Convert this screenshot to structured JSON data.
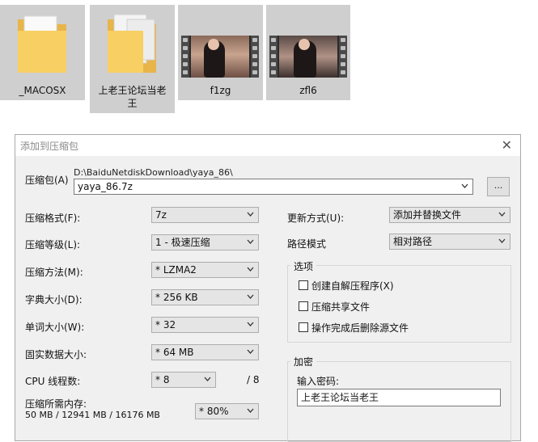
{
  "explorer": {
    "items": [
      {
        "name": "_MACOSX",
        "kind": "folder"
      },
      {
        "name": "上老王论坛当老王",
        "kind": "folder"
      },
      {
        "name": "f1zg",
        "kind": "video"
      },
      {
        "name": "zfl6",
        "kind": "video"
      }
    ]
  },
  "dialog": {
    "title": "添加到压缩包",
    "archive_label": "压缩包(A)",
    "archive_path": "D:\\BaiduNetdiskDownload\\yaya_86\\",
    "archive_name": "yaya_86.7z",
    "browse_label": "...",
    "left": [
      {
        "label": "压缩格式(F):",
        "value": "7z"
      },
      {
        "label": "压缩等级(L):",
        "value": "1 - 极速压缩"
      },
      {
        "label": "压缩方法(M):",
        "value": "* LZMA2"
      },
      {
        "label": "字典大小(D):",
        "value": "* 256 KB"
      },
      {
        "label": "单词大小(W):",
        "value": "* 32"
      },
      {
        "label": "固实数据大小:",
        "value": "* 64 MB"
      }
    ],
    "cpu": {
      "label": "CPU 线程数:",
      "value": "* 8",
      "max": "/ 8"
    },
    "memory": {
      "label": "压缩所需内存:",
      "detail": "50 MB / 12941 MB / 16176 MB",
      "value": "* 80%"
    },
    "update": {
      "label": "更新方式(U):",
      "value": "添加并替换文件"
    },
    "path_mode": {
      "label": "路径模式",
      "value": "相对路径"
    },
    "options": {
      "title": "选项",
      "items": [
        "创建自解压程序(X)",
        "压缩共享文件",
        "操作完成后删除源文件"
      ]
    },
    "encryption": {
      "title": "加密",
      "password_label": "输入密码:",
      "password_value": "上老王论坛当老王"
    }
  }
}
